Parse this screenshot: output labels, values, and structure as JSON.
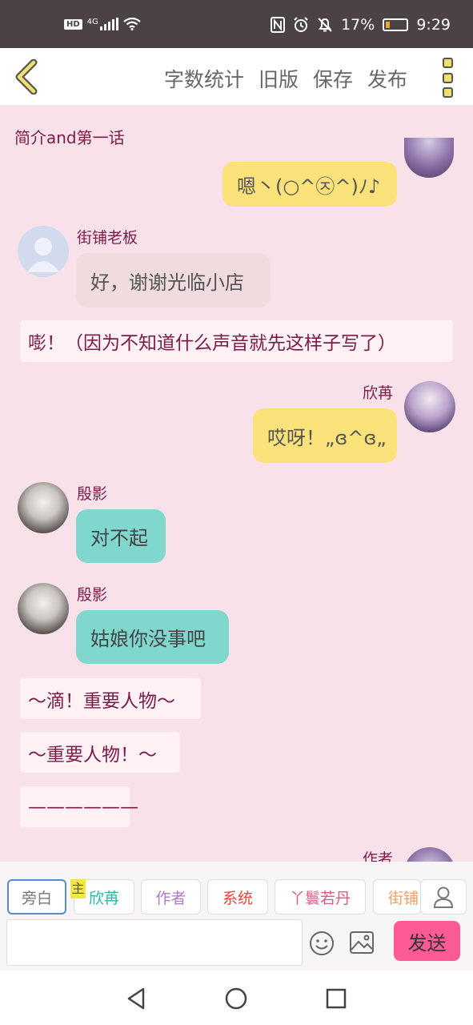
{
  "status_bar": {
    "hd": "HD",
    "network": "4G",
    "battery": "17%",
    "time": "9:29"
  },
  "toolbar": {
    "actions": [
      "字数统计",
      "旧版",
      "保存",
      "发布"
    ]
  },
  "chapter": {
    "title": "简介and第一话"
  },
  "messages": {
    "m1": {
      "text": "嗯丶(○^㉨^)ﾉ♪"
    },
    "m2": {
      "speaker": "街铺老板",
      "text": "好，谢谢光临小店"
    },
    "m3": {
      "text": "嘭！（因为不知道什么声音就先这样子写了）"
    },
    "m4": {
      "speaker": "欣苒",
      "text": "哎呀！„ɞ^ɞ„"
    },
    "m5": {
      "speaker": "殷影",
      "text": "对不起"
    },
    "m6": {
      "speaker": "殷影",
      "text": "姑娘你没事吧"
    },
    "m7": {
      "text": "～滴！重要人物～"
    },
    "m8": {
      "text": "～重要人物！～"
    },
    "m9": {
      "text": "——————"
    },
    "m10": {
      "speaker": "作者"
    }
  },
  "roles": {
    "items": [
      {
        "label": "旁白",
        "color": "#777777"
      },
      {
        "label": "欣苒",
        "color": "#2bb8a8"
      },
      {
        "label": "作者",
        "color": "#b07ac8"
      },
      {
        "label": "系统",
        "color": "#e0473c"
      },
      {
        "label": "丫鬟若丹",
        "color": "#e05a86"
      },
      {
        "label": "街铺",
        "color": "#f0a060"
      }
    ],
    "main_tag": "主"
  },
  "composer": {
    "value": "",
    "placeholder": "",
    "send_label": "发送"
  },
  "colors": {
    "accent": "#fe5a96",
    "chat_bg": "#f9e1ea",
    "yellow_bubble": "#fce27a",
    "teal_bubble": "#7fd7cd"
  }
}
